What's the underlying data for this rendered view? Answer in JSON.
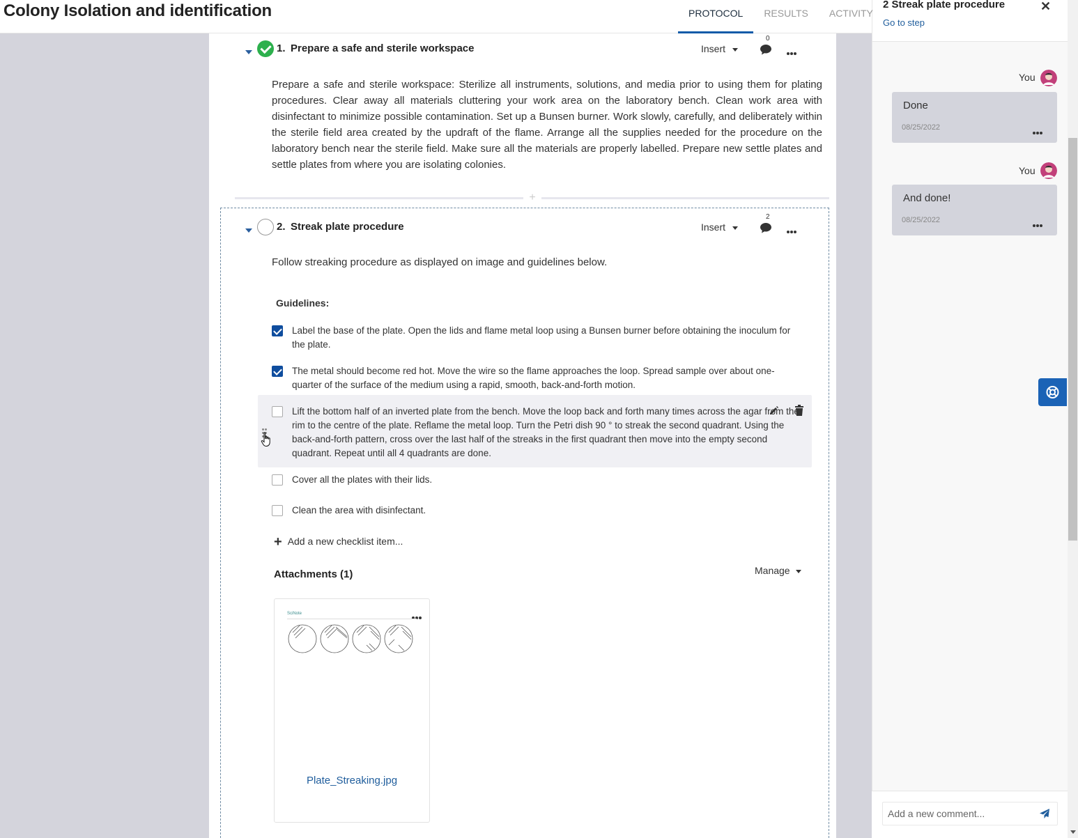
{
  "header": {
    "title": "Colony Isolation and identification",
    "tabs": [
      {
        "label": "PROTOCOL",
        "active": true
      },
      {
        "label": "RESULTS",
        "active": false
      },
      {
        "label": "ACTIVITY",
        "active": false
      }
    ]
  },
  "steps": [
    {
      "number": "1.",
      "title": "Prepare a safe and sterile workspace",
      "status": "completed",
      "insert_label": "Insert",
      "comment_count": "0",
      "text": "Prepare a safe and sterile workspace: Sterilize all instruments, solutions, and media prior to using them for plating procedures. Clear away all materials cluttering your work area on the laboratory bench. Clean work area with disinfectant to minimize possible contamination. Set up a Bunsen burner. Work slowly, carefully, and deliberately within the sterile field area created by the updraft of the flame. Arrange all the supplies needed for the procedure on the laboratory bench near the sterile field. Make sure all the materials are properly labelled. Prepare new settle plates and settle plates from where you are isolating colonies."
    },
    {
      "number": "2.",
      "title": "Streak plate procedure",
      "status": "open",
      "insert_label": "Insert",
      "comment_count": "2",
      "text": "Follow streaking procedure as displayed on image and guidelines below.",
      "checklist_title": "Guidelines:",
      "checklist": [
        {
          "text": "Label the base of the plate. Open the lids and flame metal loop using a Bunsen burner before obtaining the inoculum for the plate.",
          "checked": true
        },
        {
          "text": "The metal should become red hot. Move the wire so the flame approaches the loop. Spread sample over about one-quarter of the surface of the medium using a rapid, smooth, back-and-forth motion.",
          "checked": true
        },
        {
          "text": "Lift the bottom half of an inverted plate from the bench. Move the loop back and forth many times across the agar from the rim to the centre of the plate. Reflame the metal loop. Turn the Petri dish 90 ° to streak the second quadrant. Using the back-and-forth pattern, cross over the last half of the streaks in the first quadrant then move into the empty second quadrant. Repeat until all 4 quadrants are done.",
          "checked": false
        },
        {
          "text": "Cover all the plates with their lids.",
          "checked": false
        },
        {
          "text": "Clean the area with disinfectant.",
          "checked": false
        }
      ],
      "add_item_label": "Add a new checklist item...",
      "attachments_title": "Attachments (1)",
      "manage_label": "Manage",
      "attachments": [
        {
          "filename": "Plate_Streaking.jpg",
          "thumb_logo": "SciNote"
        }
      ]
    }
  ],
  "comments_panel": {
    "title": "2 Streak plate procedure",
    "goto_label": "Go to step",
    "comments": [
      {
        "author": "You",
        "text": "Done",
        "date": "08/25/2022"
      },
      {
        "author": "You",
        "text": "And done!",
        "date": "08/25/2022"
      }
    ],
    "input_placeholder": "Add a new comment..."
  },
  "colors": {
    "accent": "#0f5aa8",
    "done_green": "#2db04d",
    "checkbox_blue": "#0f4d9e",
    "link": "#1f5d9c",
    "workspace_bg": "#d4d4dc",
    "help_button": "#1b63b6"
  },
  "icons": [
    "check-circle-icon",
    "caret-down-icon",
    "comment-icon",
    "more-icon",
    "drag-handle-icon",
    "hand-cursor-icon",
    "pencil-icon",
    "trash-icon",
    "plus-icon",
    "close-icon",
    "lifebuoy-icon",
    "send-icon",
    "avatar"
  ]
}
